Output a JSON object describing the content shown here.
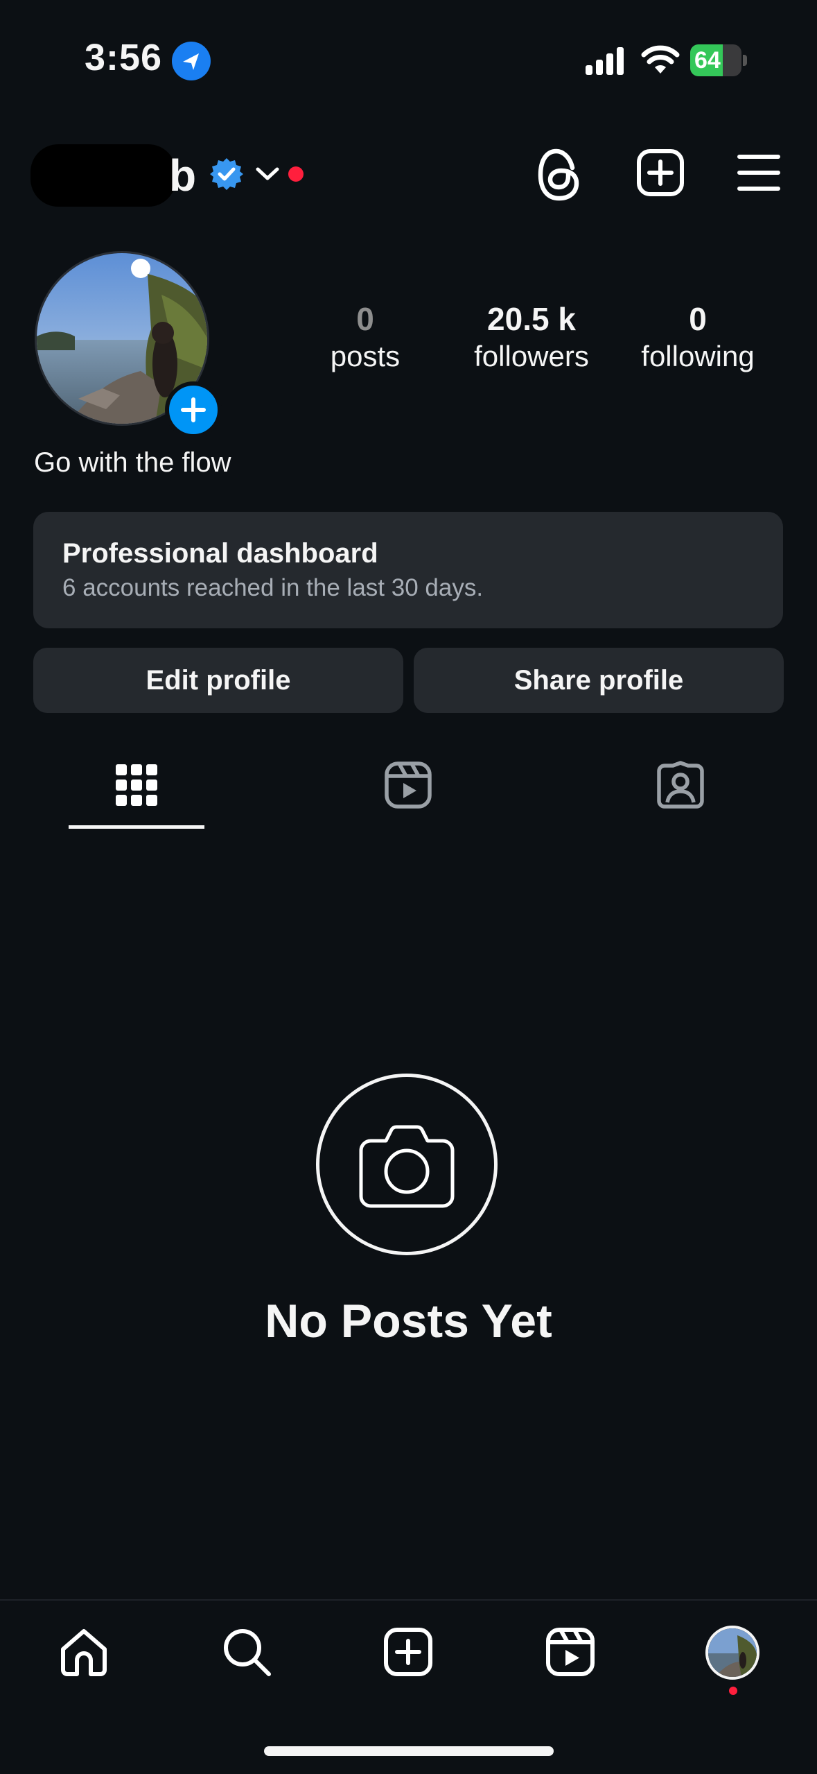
{
  "status_bar": {
    "time": "3:56",
    "battery": "64",
    "battery_level": 0.64,
    "icons": [
      "location-arrow-icon",
      "cellular-signal-icon",
      "wifi-icon",
      "battery-charging-icon"
    ]
  },
  "header": {
    "username_visible": "b",
    "icons": [
      "verified-badge-icon",
      "chevron-down-icon",
      "notification-dot",
      "threads-icon",
      "create-plus-icon",
      "menu-icon"
    ]
  },
  "profile": {
    "stats": [
      {
        "value": "0",
        "label": "posts"
      },
      {
        "value": "20.5 k",
        "label": "followers"
      },
      {
        "value": "0",
        "label": "following"
      }
    ],
    "bio": "Go with the flow"
  },
  "dashboard": {
    "title": "Professional dashboard",
    "subtitle": "6 accounts reached in the last 30 days."
  },
  "buttons": {
    "edit": "Edit profile",
    "share": "Share profile"
  },
  "tabs": [
    "grid-icon",
    "reels-icon",
    "tagged-icon"
  ],
  "empty_state": {
    "text": "No Posts Yet",
    "icon": "camera-icon"
  },
  "bottom_nav": [
    "home-icon",
    "search-icon",
    "create-icon",
    "reels-icon",
    "profile-avatar"
  ],
  "colors": {
    "background": "#0c1014",
    "accent_blue": "#0095f6",
    "card": "#25292e",
    "notification_red": "#ff1f3d",
    "battery_green": "#34c759"
  }
}
